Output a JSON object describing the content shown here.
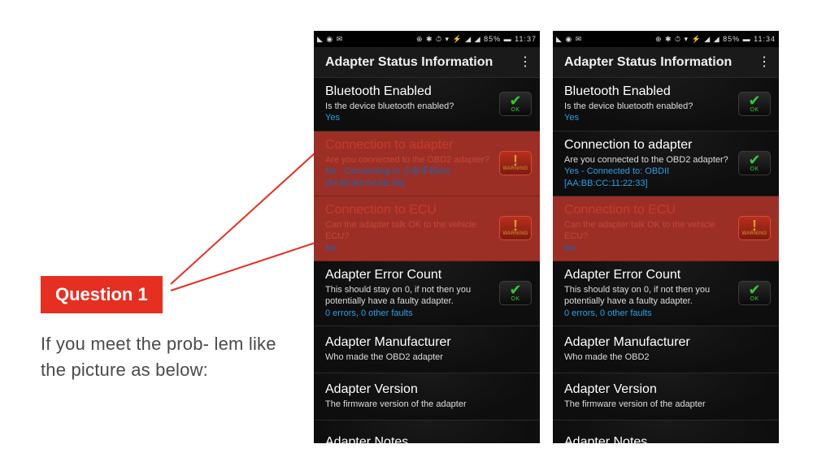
{
  "callout": {
    "badge": "Question 1",
    "text": "If you meet the prob- lem like the picture as below:"
  },
  "phones": [
    {
      "status": {
        "left_icons": "◣ ◉ ✉",
        "right": "⊕ ✱ ⏱ ▾ ⚡ ◢ ◢ 85% ▬ 11:37"
      },
      "appbar": {
        "title": "Adapter Status Information"
      },
      "items": [
        {
          "title": "Bluetooth Enabled",
          "sub": "Is the device bluetooth enabled?",
          "val": "Yes",
          "state": "ok"
        },
        {
          "title": "Connection to adapter",
          "sub": "Are you connected to the OBD2 adapter?",
          "val": "No - Connecting to 小米手机eto [34:80:B3:04:5E:5B]",
          "state": "warn",
          "error": true
        },
        {
          "title": "Connection to ECU",
          "sub": "Can the adapter talk OK to the vehicle ECU?",
          "val": "No",
          "state": "warn",
          "error": true
        },
        {
          "title": "Adapter Error Count",
          "sub": "This should stay on 0, if not then you potentially have a faulty adapter.",
          "val": "0 errors, 0 other faults",
          "state": "ok"
        },
        {
          "title": "Adapter Manufacturer",
          "sub": "Who made the OBD2 adapter",
          "val": "",
          "state": ""
        },
        {
          "title": "Adapter Version",
          "sub": "The firmware version of the adapter",
          "val": "",
          "state": ""
        },
        {
          "title": "Adapter Notes",
          "sub": "",
          "val": "",
          "state": ""
        }
      ]
    },
    {
      "status": {
        "left_icons": "◣ ◉ ✉",
        "right": "⊕ ✱ ⏱ ▾ ⚡ ◢ ◢ 85% ▬ 11:34"
      },
      "appbar": {
        "title": "Adapter Status Information"
      },
      "items": [
        {
          "title": "Bluetooth Enabled",
          "sub": "Is the device bluetooth enabled?",
          "val": "Yes",
          "state": "ok"
        },
        {
          "title": "Connection to adapter",
          "sub": "Are you connected to the OBD2 adapter?",
          "val": "Yes - Connected to: OBDII [AA:BB:CC:11:22:33]",
          "state": "ok"
        },
        {
          "title": "Connection to ECU",
          "sub": "Can the adapter talk OK to the vehicle ECU?",
          "val": "No",
          "state": "warn",
          "error": true
        },
        {
          "title": "Adapter Error Count",
          "sub": "This should stay on 0, if not then you potentially have a faulty adapter.",
          "val": "0 errors, 0 other faults",
          "state": "ok"
        },
        {
          "title": "Adapter Manufacturer",
          "sub": "Who made the OBD2",
          "val": "",
          "state": ""
        },
        {
          "title": "Adapter Version",
          "sub": "The firmware version of the adapter",
          "val": "",
          "state": ""
        },
        {
          "title": "Adapter Notes",
          "sub": "",
          "val": "",
          "state": ""
        }
      ]
    }
  ],
  "icon_labels": {
    "ok": "OK",
    "warn": "WARNING"
  }
}
